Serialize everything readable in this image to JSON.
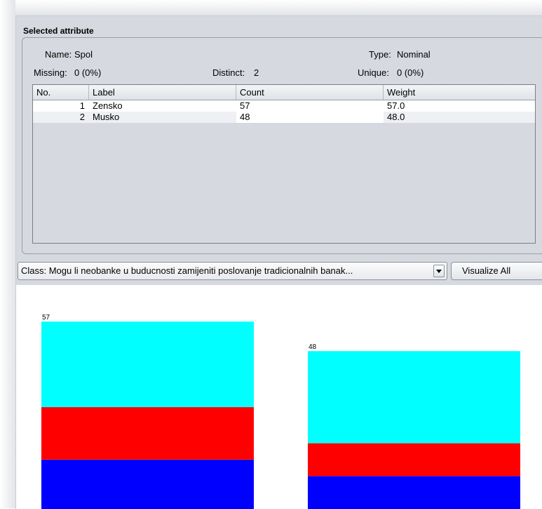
{
  "panel": {
    "title": "Selected attribute"
  },
  "attribute": {
    "name_label": "Name:",
    "name_value": "Spol",
    "type_label": "Type:",
    "type_value": "Nominal",
    "missing_label": "Missing:",
    "missing_value": "0 (0%)",
    "distinct_label": "Distinct:",
    "distinct_value": "2",
    "unique_label": "Unique:",
    "unique_value": "0 (0%)"
  },
  "table": {
    "headers": [
      "No.",
      "Label",
      "Count",
      "Weight"
    ],
    "rows": [
      {
        "no": "1",
        "label": "Zensko",
        "count": "57",
        "weight": "57.0"
      },
      {
        "no": "2",
        "label": "Musko",
        "count": "48",
        "weight": "48.0"
      }
    ]
  },
  "class_selector": {
    "value": "Class: Mogu li neobanke u buducnosti zamijeniti poslovanje tradicionalnih banak..."
  },
  "visualize_all": {
    "label": "Visualize All"
  },
  "colors": {
    "cyan": "#00ffff",
    "red": "#ff0000",
    "blue": "#0000ff"
  },
  "chart_data": {
    "type": "bar",
    "stacked": true,
    "categories": [
      "Zensko",
      "Musko"
    ],
    "bar_labels": [
      "57",
      "48"
    ],
    "series": [
      {
        "values": [
          15,
          10
        ],
        "color": "#0000ff"
      },
      {
        "values": [
          16,
          10
        ],
        "color": "#ff0000"
      },
      {
        "values": [
          26,
          28
        ],
        "color": "#00ffff"
      }
    ],
    "ylim": [
      0,
      57
    ]
  }
}
